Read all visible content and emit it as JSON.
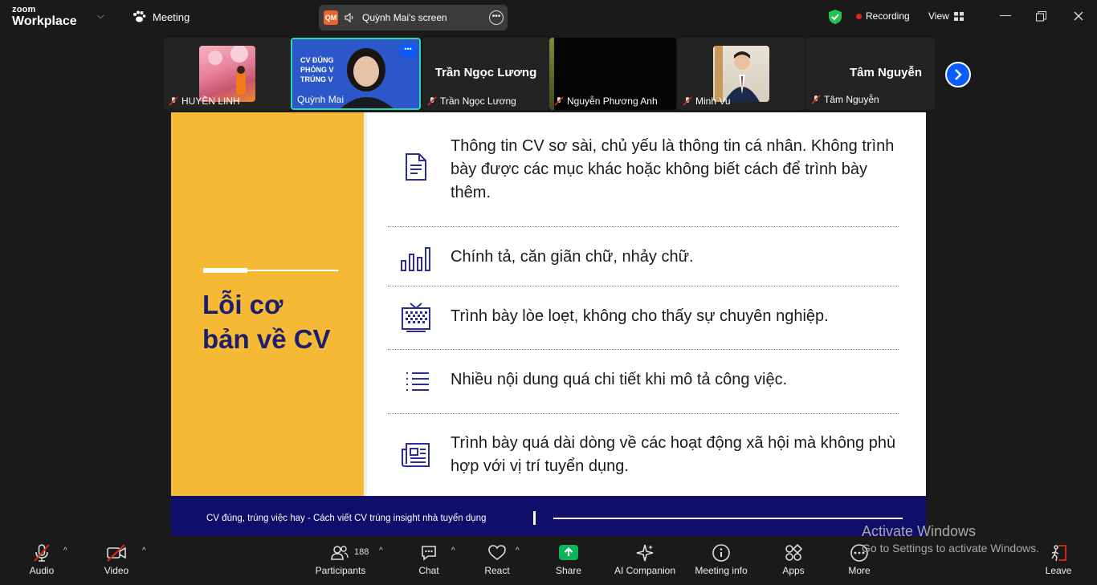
{
  "app": {
    "brand_top": "zoom",
    "brand_bottom": "Workplace",
    "meeting_label": "Meeting"
  },
  "share_pill": {
    "initials": "QM",
    "label": "Quỳnh Mai's screen"
  },
  "status": {
    "recording": "Recording",
    "view": "View"
  },
  "participants": [
    {
      "name": "HUYỀN LINH",
      "muted": true,
      "type": "photo"
    },
    {
      "name": "Quỳnh Mai",
      "muted": false,
      "type": "video",
      "active": true
    },
    {
      "name": "Trần Ngọc Lương",
      "muted": true,
      "type": "text",
      "display": "Trần Ngọc Lương"
    },
    {
      "name": "Nguyễn Phương Anh",
      "muted": true,
      "type": "dark"
    },
    {
      "name": "Minh Vu",
      "muted": true,
      "type": "photo"
    },
    {
      "name": "Tâm Nguyễn",
      "muted": true,
      "type": "text",
      "display": "Tâm Nguyễn"
    }
  ],
  "thumb_video_text": {
    "l1": "CV ĐÚNG",
    "l2": "PHỎNG V",
    "l3": "TRÚNG V"
  },
  "slide": {
    "title": "Lỗi cơ bản về CV",
    "title_l1": "Lỗi cơ",
    "title_l2": "bản về CV",
    "items": [
      {
        "icon": "document-icon",
        "text": "Thông tin CV sơ sài, chủ yếu là thông tin cá nhân. Không trình bày được các mục khác hoặc không biết cách để trình bày thêm."
      },
      {
        "icon": "bar-chart-icon",
        "text": "Chính tả, căn giãn chữ, nhảy chữ."
      },
      {
        "icon": "tv-icon",
        "text": "Trình bày lòe loẹt, không cho thấy sự chuyên nghiệp."
      },
      {
        "icon": "list-icon",
        "text": "Nhiều nội dung quá chi tiết khi mô tả công việc."
      },
      {
        "icon": "newspaper-icon",
        "text": "Trình bày quá dài dòng về các hoạt động xã hội mà không phù hợp với vị trí tuyển dụng."
      }
    ],
    "footer": "CV đúng, trúng việc hay - Cách viết CV trúng insight nhà tuyển dụng"
  },
  "toolbar": {
    "audio": "Audio",
    "video": "Video",
    "participants": "Participants",
    "participants_count": "188",
    "chat": "Chat",
    "react": "React",
    "share": "Share",
    "ai": "AI Companion",
    "info": "Meeting info",
    "apps": "Apps",
    "more": "More",
    "leave": "Leave"
  },
  "watermark": {
    "line1": "Activate Windows",
    "line2": "Go to Settings to activate Windows."
  },
  "colors": {
    "accent": "#0b5cff",
    "slide_yellow": "#f6b935",
    "slide_navy": "#0f0e6b",
    "share_green": "#0cb55a",
    "active_border": "#2fd6b5"
  }
}
